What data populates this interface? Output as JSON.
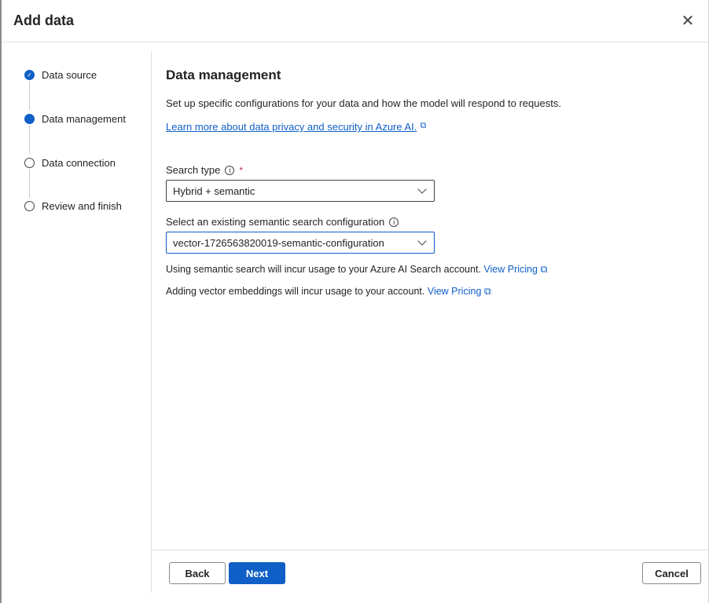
{
  "dialog": {
    "title": "Add data",
    "close_icon": "close-icon"
  },
  "steps": [
    {
      "label": "Data source",
      "state": "completed"
    },
    {
      "label": "Data management",
      "state": "current"
    },
    {
      "label": "Data connection",
      "state": "pending"
    },
    {
      "label": "Review and finish",
      "state": "pending"
    }
  ],
  "main": {
    "heading": "Data management",
    "description": "Set up specific configurations for your data and how the model will respond to requests.",
    "learn_link": "Learn more about data privacy and security in Azure AI.",
    "search_type": {
      "label": "Search type",
      "required": "*",
      "value": "Hybrid + semantic"
    },
    "semantic_config": {
      "label": "Select an existing semantic search configuration",
      "value": "vector-1726563820019-semantic-configuration"
    },
    "notes": [
      {
        "text": "Using semantic search will incur usage to your Azure AI Search account.",
        "link": "View Pricing"
      },
      {
        "text": "Adding vector embeddings will incur usage to your account.",
        "link": "View Pricing"
      }
    ]
  },
  "footer": {
    "back": "Back",
    "next": "Next",
    "cancel": "Cancel"
  },
  "colors": {
    "accent": "#0f5fc7",
    "required": "#c4314b"
  }
}
